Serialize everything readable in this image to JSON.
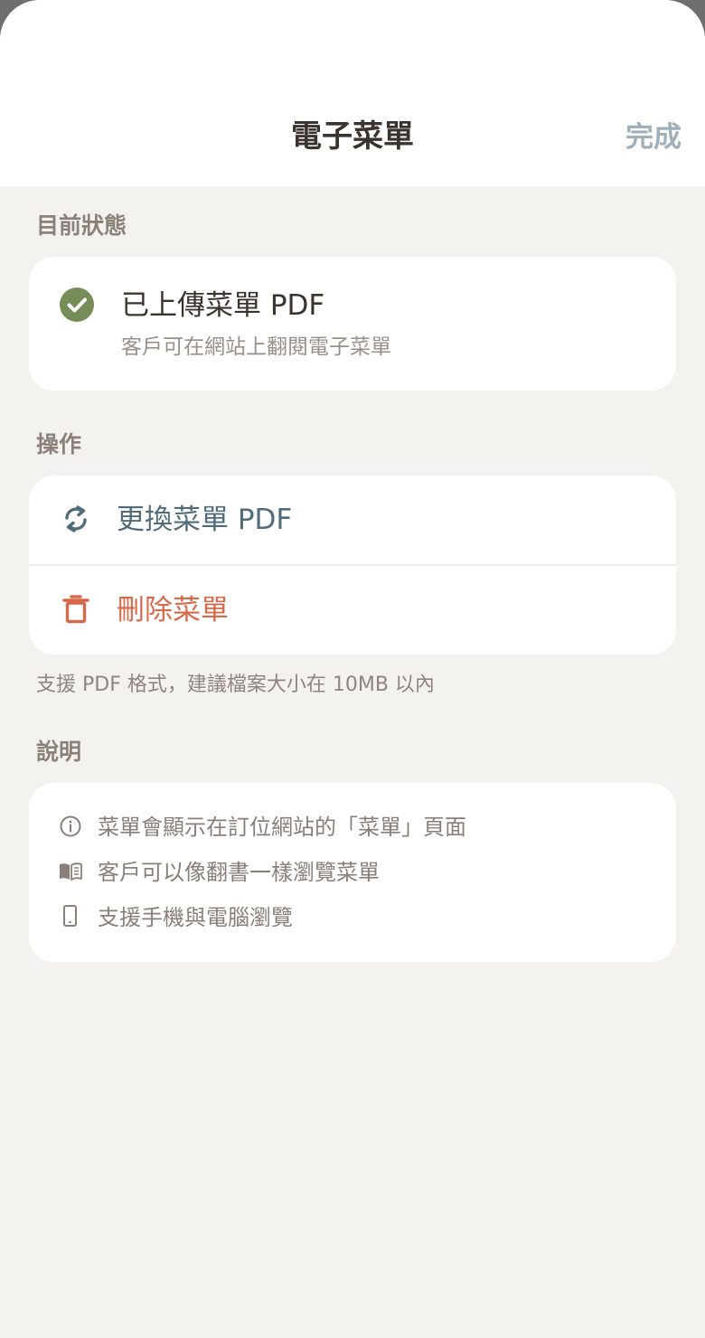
{
  "header": {
    "title": "電子菜單",
    "done_label": "完成"
  },
  "status": {
    "section_label": "目前狀態",
    "title": "已上傳菜單 PDF",
    "subtitle": "客戶可在網站上翻閱電子菜單",
    "icon": "check-circle-icon"
  },
  "actions": {
    "section_label": "操作",
    "replace_label": "更換菜單 PDF",
    "replace_icon": "refresh-icon",
    "delete_label": "刪除菜單",
    "delete_icon": "trash-icon",
    "hint": "支援 PDF 格式，建議檔案大小在 10MB 以內"
  },
  "info": {
    "section_label": "說明",
    "items": [
      {
        "text": "菜單會顯示在訂位網站的「菜單」頁面",
        "icon": "info-icon"
      },
      {
        "text": "客戶可以像翻書一樣瀏覽菜單",
        "icon": "book-icon"
      },
      {
        "text": "支援手機與電腦瀏覽",
        "icon": "phone-icon"
      }
    ]
  },
  "colors": {
    "accent_green": "#778d57",
    "action_blue": "#506c7b",
    "danger": "#d8684a",
    "done_gray": "#9fb0bb",
    "background": "#f3f2ef"
  }
}
